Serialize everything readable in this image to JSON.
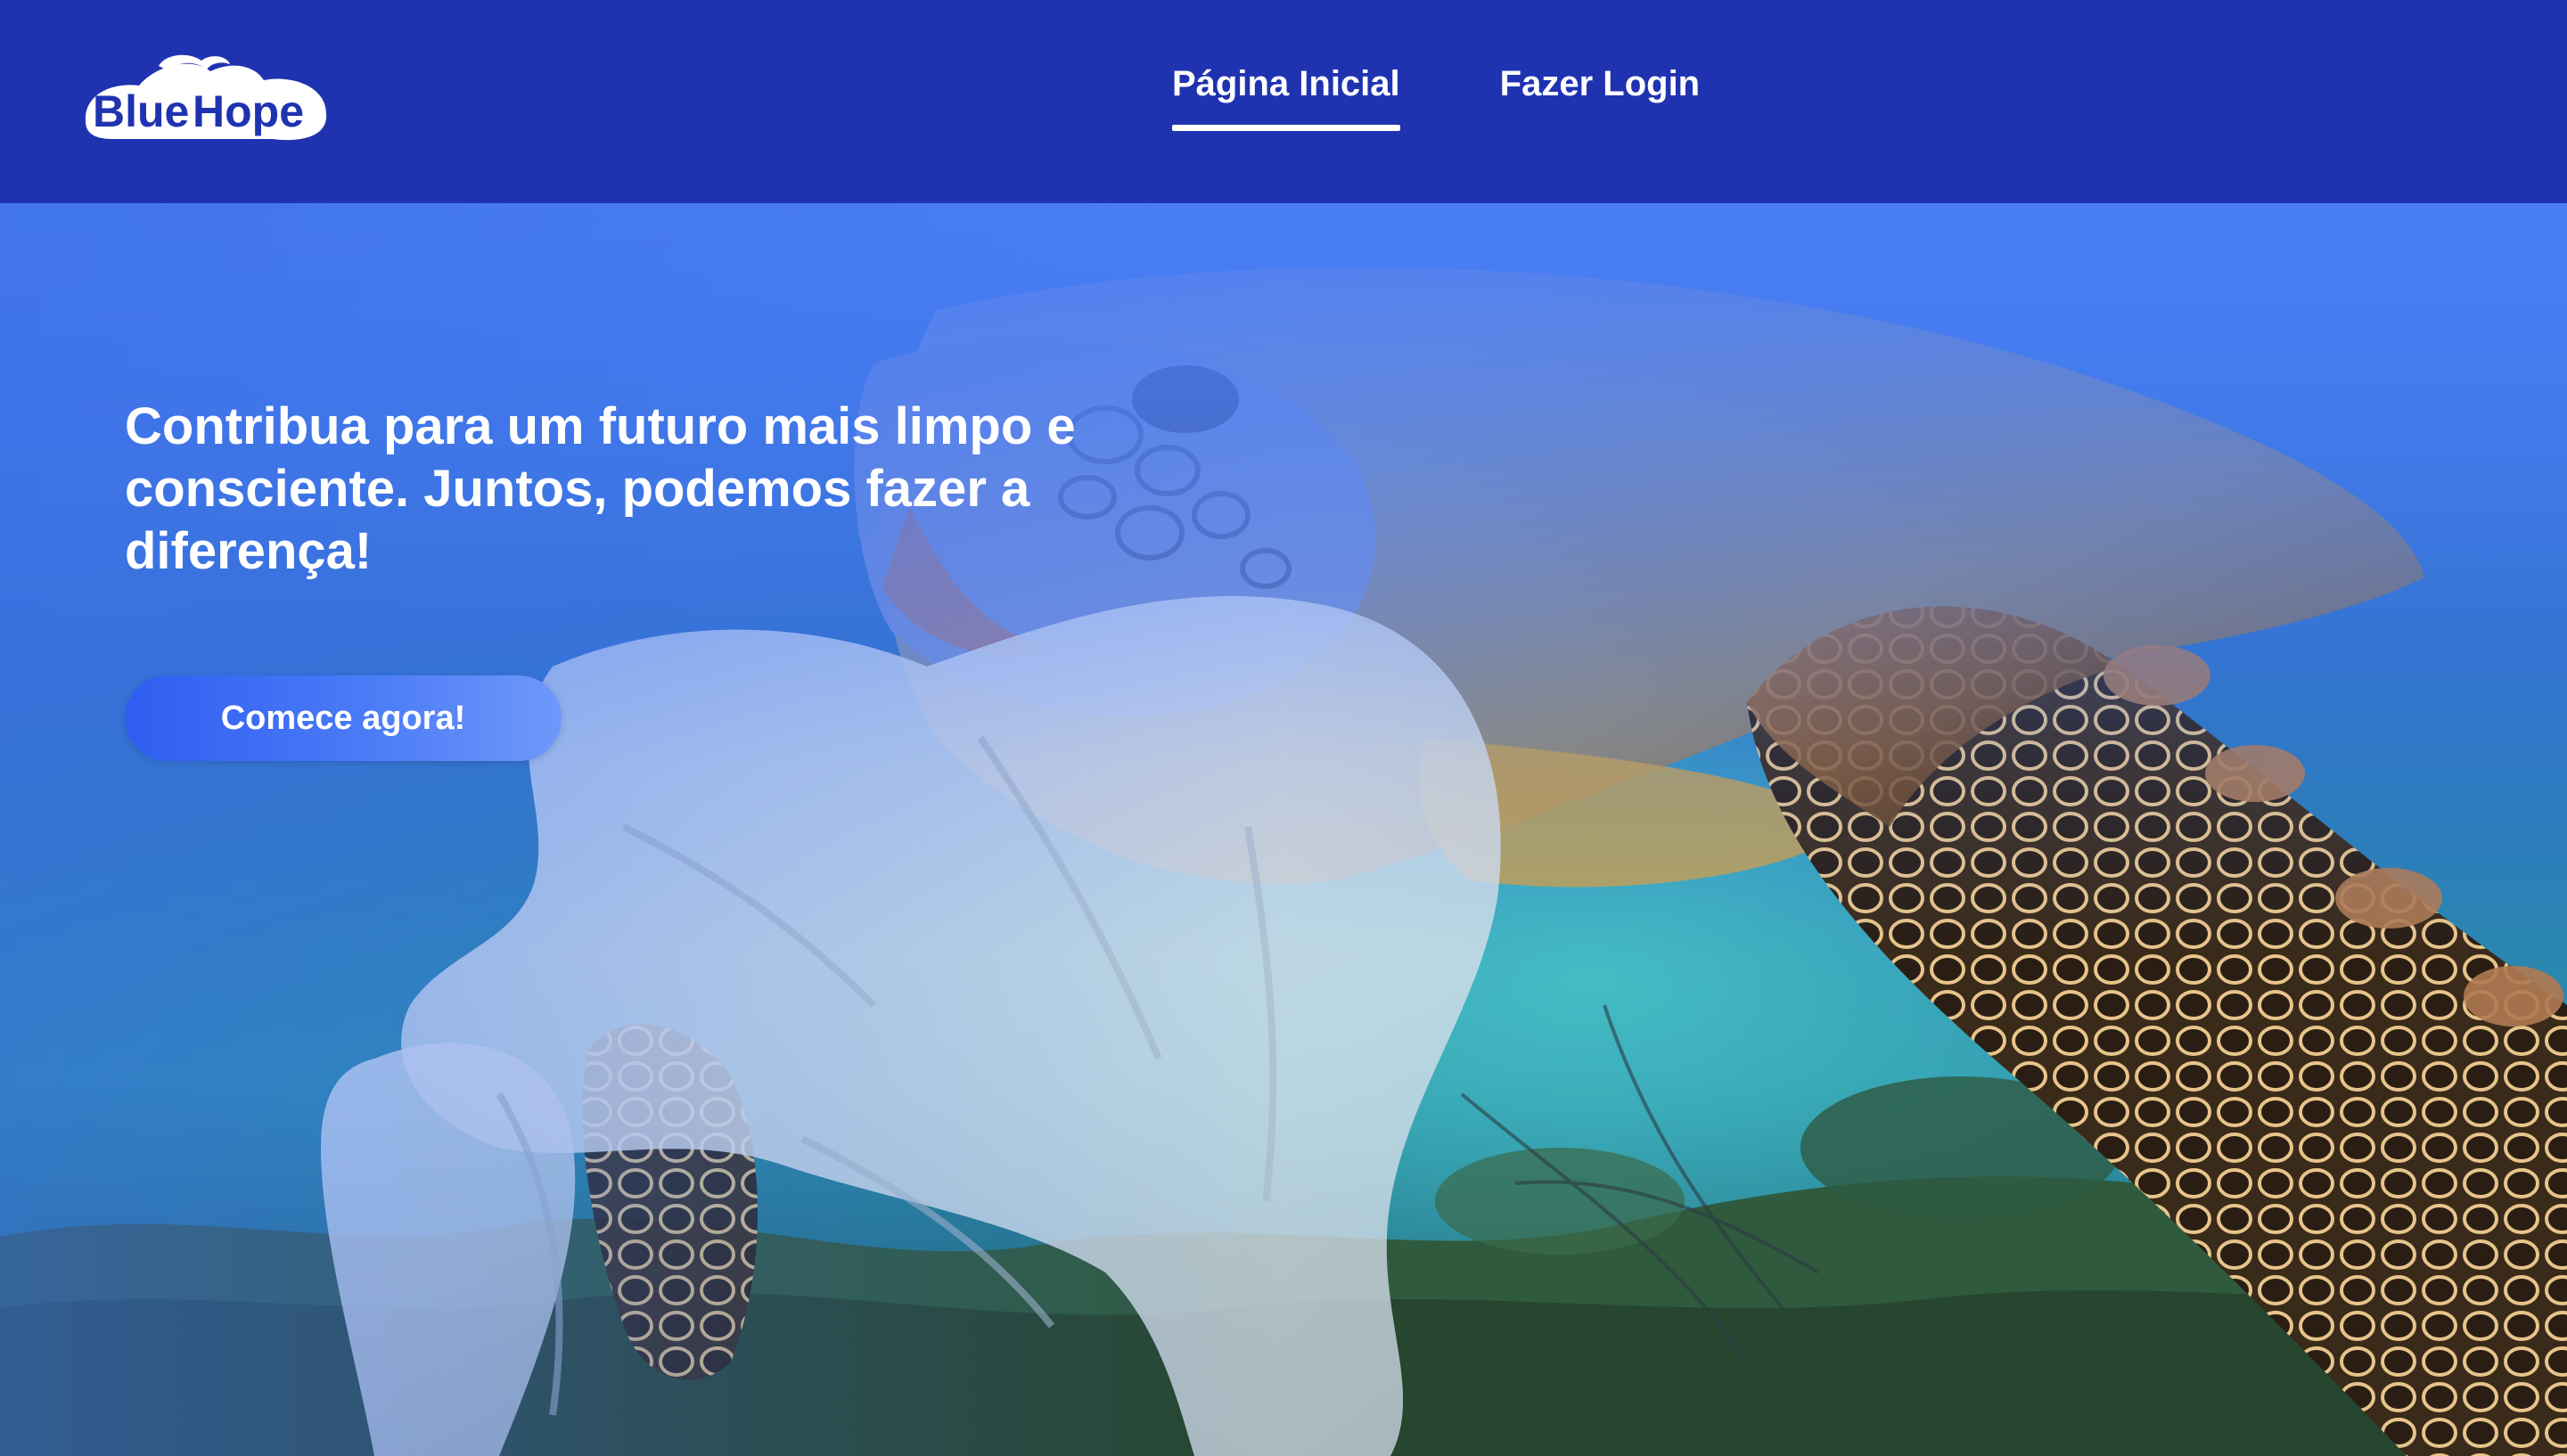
{
  "brand": {
    "logo_text_part1": "Blue",
    "logo_text_part2": "Hope",
    "color_primary": "#1f33b1",
    "color_accent": "#4a7bf6"
  },
  "nav": {
    "items": [
      {
        "label": "Página Inicial",
        "active": true
      },
      {
        "label": "Fazer Login",
        "active": false
      }
    ]
  },
  "hero": {
    "title": "Contribua para um futuro mais limpo e consciente. Juntos, podemos fazer a diferença!",
    "cta_label": "Comece agora!",
    "image_subject": "sea-turtle-with-plastic-bag-underwater"
  }
}
